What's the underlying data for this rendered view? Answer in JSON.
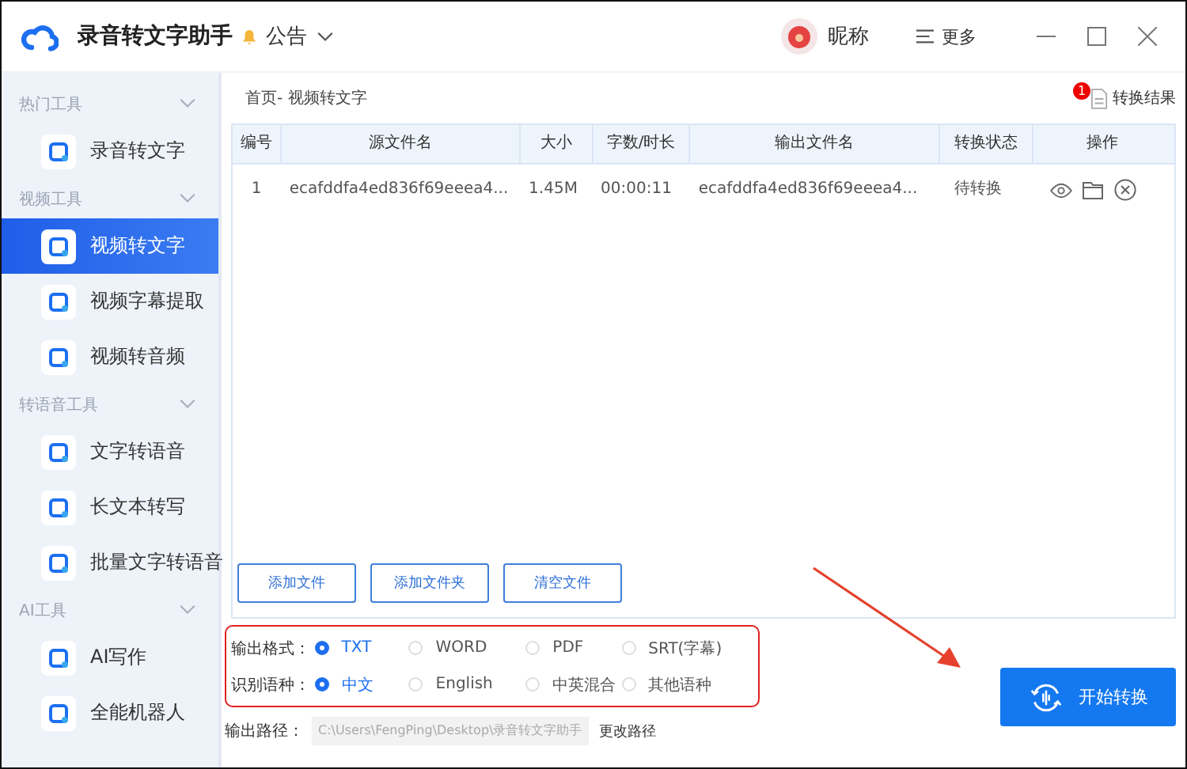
{
  "app": {
    "title": "录音转文字助手",
    "notice": "公告",
    "user": "昵称",
    "more": "更多"
  },
  "sidebar": [
    {
      "header": "热门工具",
      "expanded": true,
      "items": [
        {
          "label": "录音转文字",
          "selected": false
        }
      ]
    },
    {
      "header": "视频工具",
      "expanded": true,
      "items": [
        {
          "label": "视频转文字",
          "selected": true
        },
        {
          "label": "视频字幕提取",
          "selected": false
        },
        {
          "label": "视频转音频",
          "selected": false
        }
      ]
    },
    {
      "header": "转语音工具",
      "expanded": true,
      "items": [
        {
          "label": "文字转语音",
          "selected": false
        },
        {
          "label": "长文本转写",
          "selected": false
        },
        {
          "label": "批量文字转语音",
          "selected": false
        }
      ]
    },
    {
      "header": "AI工具",
      "expanded": true,
      "items": [
        {
          "label": "AI写作",
          "selected": false
        },
        {
          "label": "全能机器人",
          "selected": false
        }
      ]
    }
  ],
  "breadcrumb": "首页- 视频转文字",
  "results": {
    "label": "转换结果",
    "badge": "1"
  },
  "table": {
    "columns": [
      "编号",
      "源文件名",
      "大小",
      "字数/时长",
      "输出文件名",
      "转换状态",
      "操作"
    ],
    "rows": [
      {
        "cells": [
          "1",
          "ecafddfa4ed836f69eeea4...",
          "1.45M",
          "00:00:11",
          "ecafddfa4ed836f69eeea4...",
          "待转换"
        ]
      }
    ]
  },
  "file_buttons": [
    "添加文件",
    "添加文件夹",
    "清空文件"
  ],
  "options": [
    {
      "label": "输出格式：",
      "choices": [
        {
          "label": "TXT",
          "selected": true
        },
        {
          "label": "WORD",
          "selected": false
        },
        {
          "label": "PDF",
          "selected": false
        },
        {
          "label": "SRT(字幕)",
          "selected": false
        }
      ]
    },
    {
      "label": "识别语种：",
      "choices": [
        {
          "label": "中文",
          "selected": true
        },
        {
          "label": "English",
          "selected": false
        },
        {
          "label": "中英混合",
          "selected": false
        },
        {
          "label": "其他语种",
          "selected": false
        }
      ]
    }
  ],
  "output_path": {
    "label": "输出路径：",
    "value": "C:\\Users\\FengPing\\Desktop\\录音转文字助手",
    "change": "更改路径"
  },
  "start_button": "开始转换"
}
